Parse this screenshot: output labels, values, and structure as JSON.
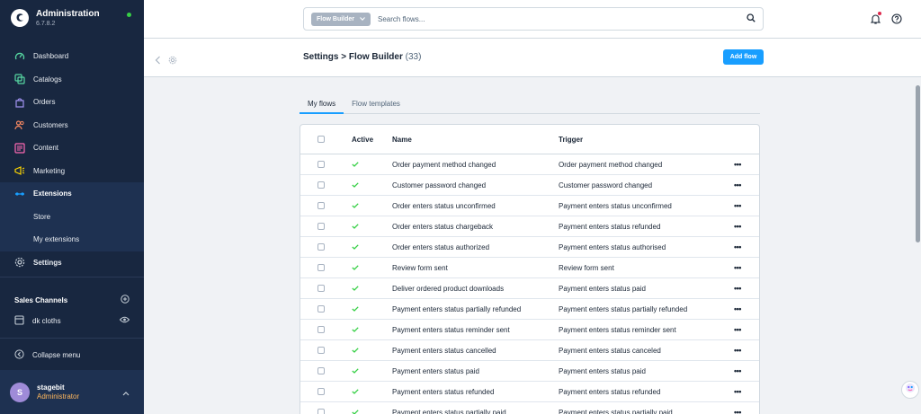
{
  "app": {
    "title": "Administration",
    "version": "6.7.8.2",
    "status_color": "#37d046"
  },
  "sidebar": {
    "items": [
      {
        "label": "Dashboard",
        "icon": "dashboard-icon",
        "color": "#57d9a3"
      },
      {
        "label": "Catalogs",
        "icon": "catalogs-icon",
        "color": "#57d9a3"
      },
      {
        "label": "Orders",
        "icon": "orders-icon",
        "color": "#a092f0"
      },
      {
        "label": "Customers",
        "icon": "customers-icon",
        "color": "#f88962"
      },
      {
        "label": "Content",
        "icon": "content-icon",
        "color": "#ff68b4"
      },
      {
        "label": "Marketing",
        "icon": "marketing-icon",
        "color": "#ffd700"
      },
      {
        "label": "Extensions",
        "icon": "extensions-icon",
        "color": "#189eff"
      },
      {
        "label": "Settings",
        "icon": "settings-icon",
        "color": "#c4cdd6"
      }
    ],
    "extensions_sub": [
      "Store",
      "My extensions"
    ],
    "sales_channels_title": "Sales Channels",
    "channel_name": "dk cloths",
    "collapse_label": "Collapse menu",
    "user": {
      "initial": "S",
      "name": "stagebit",
      "role": "Administrator"
    }
  },
  "header": {
    "search_type": "Flow Builder",
    "search_placeholder": "Search flows..."
  },
  "page": {
    "breadcrumb": "Settings > Flow Builder",
    "count": "(33)",
    "add_button": "Add flow"
  },
  "tabs": [
    "My flows",
    "Flow templates"
  ],
  "table": {
    "columns": [
      "Active",
      "Name",
      "Trigger"
    ],
    "rows": [
      {
        "name": "Order payment method changed",
        "trigger": "Order payment method changed"
      },
      {
        "name": "Customer password changed",
        "trigger": "Customer password changed"
      },
      {
        "name": "Order enters status unconfirmed",
        "trigger": "Payment enters status unconfirmed"
      },
      {
        "name": "Order enters status chargeback",
        "trigger": "Payment enters status refunded"
      },
      {
        "name": "Order enters status authorized",
        "trigger": "Payment enters status authorised"
      },
      {
        "name": "Review form sent",
        "trigger": "Review form sent"
      },
      {
        "name": "Deliver ordered product downloads",
        "trigger": "Payment enters status paid"
      },
      {
        "name": "Payment enters status partially refunded",
        "trigger": "Payment enters status partially refunded"
      },
      {
        "name": "Payment enters status reminder sent",
        "trigger": "Payment enters status reminder sent"
      },
      {
        "name": "Payment enters status cancelled",
        "trigger": "Payment enters status canceled"
      },
      {
        "name": "Payment enters status paid",
        "trigger": "Payment enters status paid"
      },
      {
        "name": "Payment enters status refunded",
        "trigger": "Payment enters status refunded"
      },
      {
        "name": "Payment enters status partially paid",
        "trigger": "Payment enters status partially paid"
      }
    ]
  },
  "colors": {
    "accent": "#189eff",
    "sidebar_bg": "#182740",
    "check_green": "#37d046",
    "role_orange": "#ffb75d"
  }
}
